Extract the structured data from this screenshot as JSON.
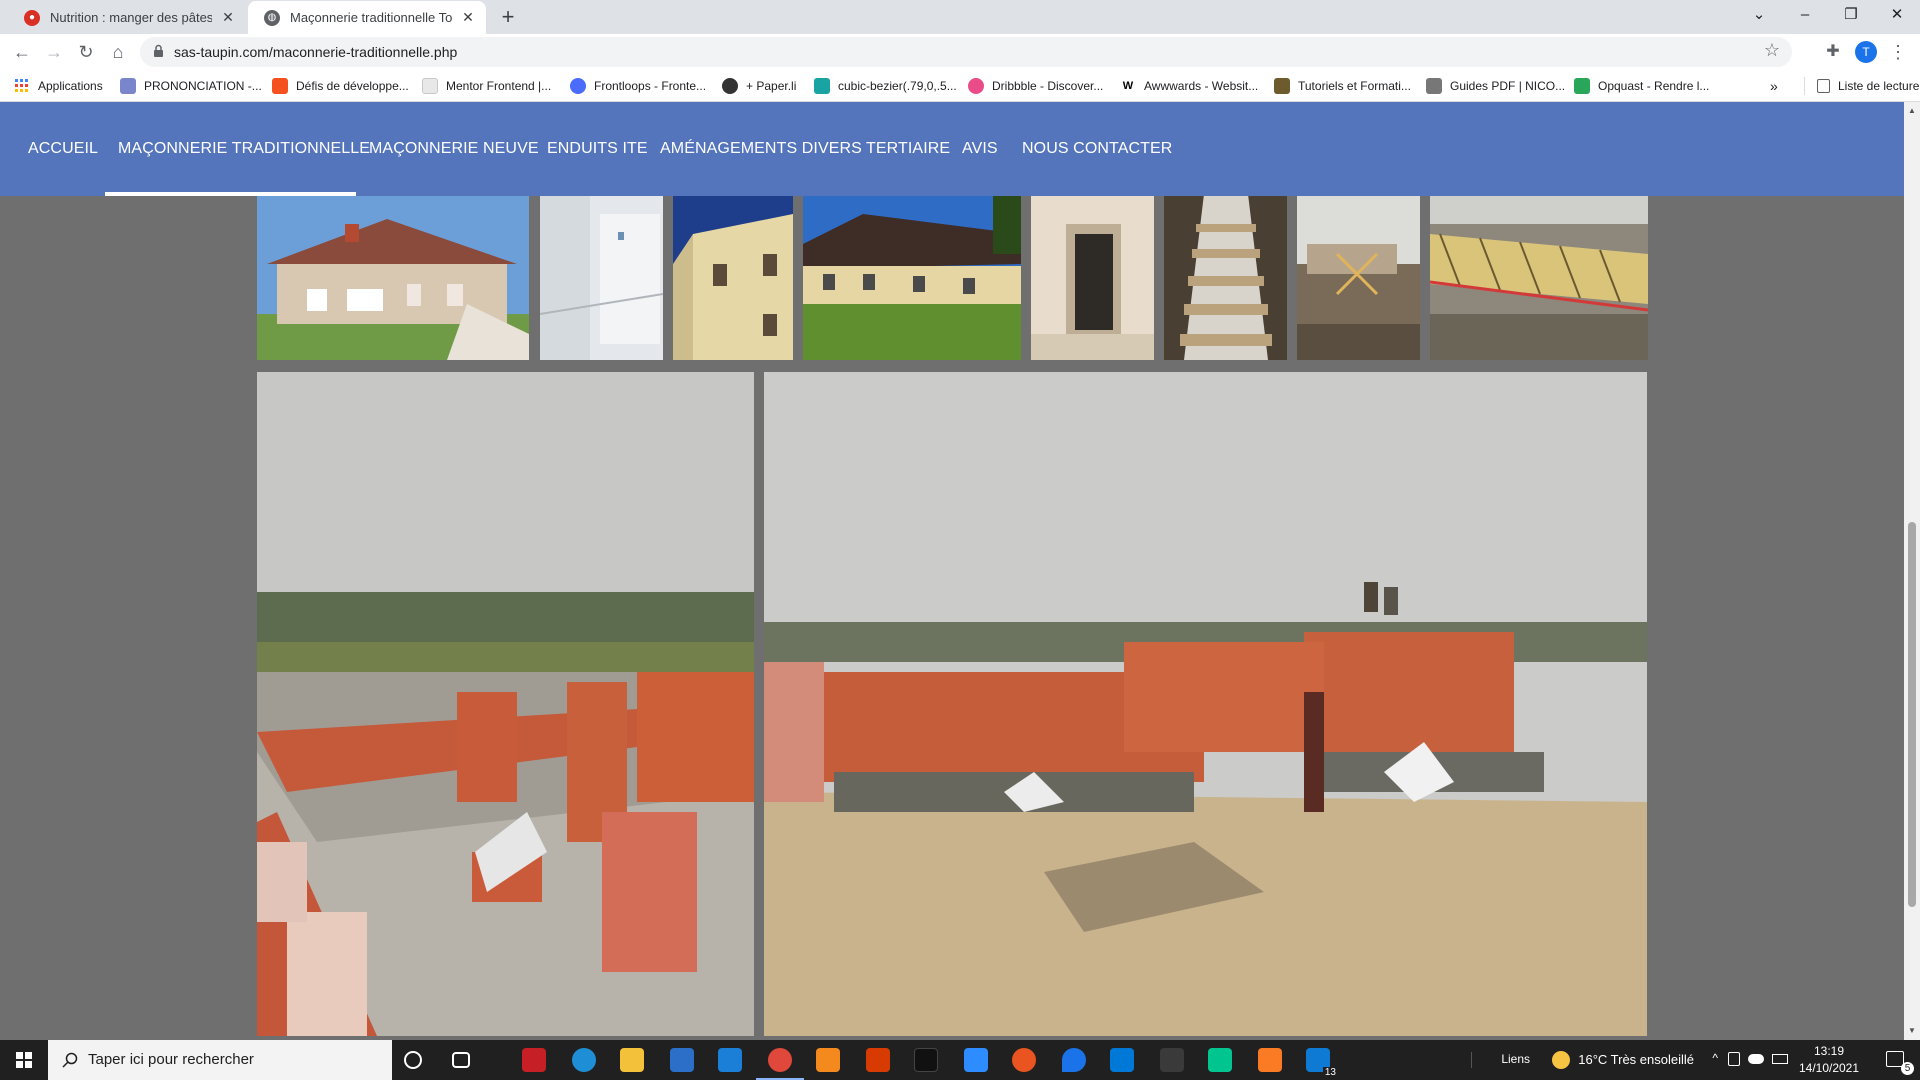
{
  "browser": {
    "tabs": [
      {
        "title": "Nutrition : manger des pâtes et c",
        "favicon": "red-circle-icon",
        "active": false
      },
      {
        "title": "Maçonnerie traditionnelle Toucy",
        "favicon": "globe-icon",
        "active": true
      }
    ],
    "new_tab_label": "+",
    "window_controls": {
      "tab_search": "⌄",
      "minimize": "–",
      "restore": "❐",
      "close": "✕"
    },
    "url": "sas-taupin.com/maconnerie-traditionnelle.php",
    "profile_initial": "T",
    "bookmarks": [
      {
        "label": "Applications",
        "icon": "apps-grid-icon",
        "color": "#4285f4"
      },
      {
        "label": "PRONONCIATION -...",
        "icon": "doc-icon",
        "color": "#7986cb"
      },
      {
        "label": "Défis de développe...",
        "icon": "challenge-icon",
        "color": "#f4511e"
      },
      {
        "label": "Mentor Frontend |...",
        "icon": "mentor-icon",
        "color": "#c7c7c7"
      },
      {
        "label": "Frontloops - Fronte...",
        "icon": "loop-icon",
        "color": "#4b6bfb"
      },
      {
        "label": "+ Paper.li",
        "icon": "paper-icon",
        "color": "#333333"
      },
      {
        "label": "cubic-bezier(.79,0,.5...",
        "icon": "bezier-icon",
        "color": "#1aa3a3"
      },
      {
        "label": "Dribbble - Discover...",
        "icon": "dribbble-icon",
        "color": "#ea4c89"
      },
      {
        "label": "Awwwards - Websit...",
        "icon": "awwwards-icon",
        "color": "#000000"
      },
      {
        "label": "Tutoriels et Formati...",
        "icon": "shield-icon",
        "color": "#6d5b2e"
      },
      {
        "label": "Guides PDF | NICO...",
        "icon": "guides-icon",
        "color": "#777777"
      },
      {
        "label": "Opquast - Rendre l...",
        "icon": "opquast-icon",
        "color": "#2aa65b"
      }
    ],
    "bookmarks_more": "»",
    "reading_list": "Liste de lecture"
  },
  "site": {
    "nav": [
      {
        "label": "ACCUEIL",
        "active": false
      },
      {
        "label": "MAÇONNERIE TRADITIONNELLE",
        "active": true
      },
      {
        "label": "MAÇONNERIE NEUVE",
        "active": false
      },
      {
        "label": "ENDUITS ITE",
        "active": false
      },
      {
        "label": "AMÉNAGEMENTS DIVERS",
        "active": false
      },
      {
        "label": "TERTIAIRE",
        "active": false
      },
      {
        "label": "AVIS",
        "active": false
      },
      {
        "label": "NOUS CONTACTER",
        "active": false
      }
    ],
    "accent_color": "#5474bb",
    "thumbnails": [
      "stone-house-photo",
      "interior-wall-photo",
      "stone-tower-photo",
      "farmhouse-lawn-photo",
      "doorway-photo",
      "stone-steps-photo",
      "foundation-site-photo",
      "rebar-slab-photo"
    ],
    "gallery": [
      "brick-walls-closeup-photo",
      "brick-house-construction-photo"
    ]
  },
  "taskbar": {
    "search_placeholder": "Taper ici pour rechercher",
    "links_label": "Liens",
    "weather": "16°C  Très ensoleillé",
    "time": "13:19",
    "date": "14/10/2021",
    "notifications": "5",
    "badge": "13"
  }
}
